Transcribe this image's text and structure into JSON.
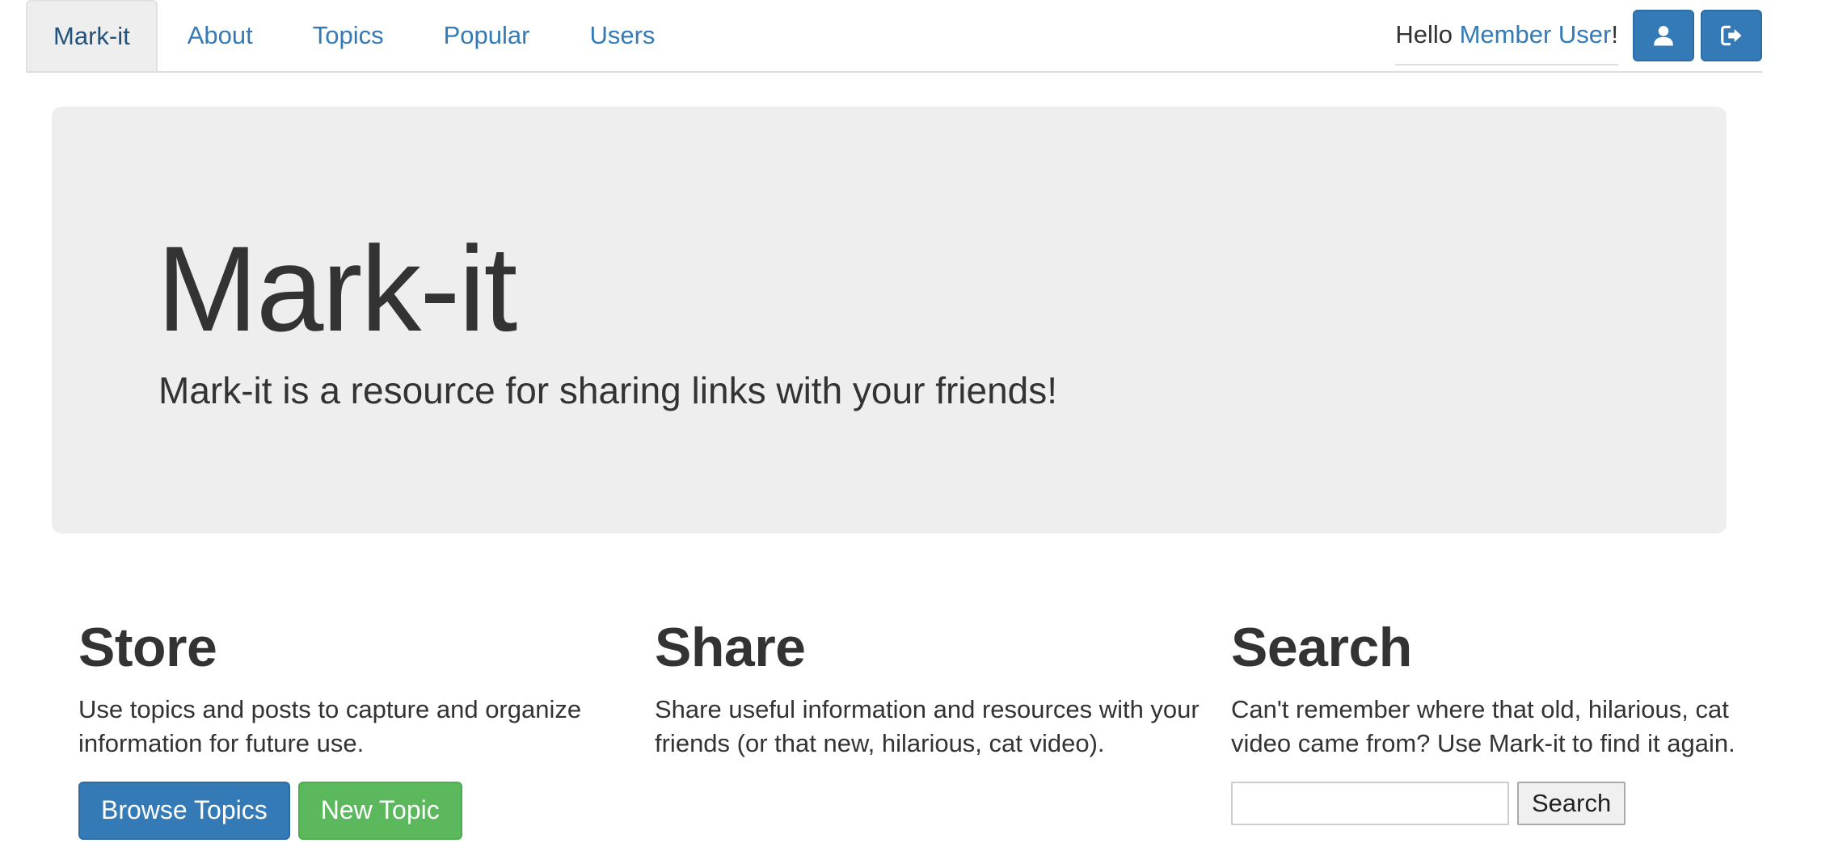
{
  "nav": {
    "tabs": [
      {
        "label": "Mark-it",
        "active": true
      },
      {
        "label": "About"
      },
      {
        "label": "Topics"
      },
      {
        "label": "Popular"
      },
      {
        "label": "Users"
      }
    ],
    "greeting_prefix": "Hello ",
    "username": "Member User",
    "greeting_suffix": "!",
    "profile_icon": "user-icon",
    "logout_icon": "logout-icon"
  },
  "jumbotron": {
    "title": "Mark-it",
    "subtitle": "Mark-it is a resource for sharing links with your friends!"
  },
  "columns": {
    "store": {
      "heading": "Store",
      "text": "Use topics and posts to capture and organize information for future use.",
      "browse_label": "Browse Topics",
      "new_label": "New Topic"
    },
    "share": {
      "heading": "Share",
      "text": "Share useful information and resources with your friends (or that new, hilarious, cat video)."
    },
    "search": {
      "heading": "Search",
      "text": "Can't remember where that old, hilarious, cat video came from? Use Mark-it to find it again.",
      "input_value": "",
      "button_label": "Search"
    }
  },
  "colors": {
    "link": "#337ab7",
    "primary": "#337ab7",
    "success": "#5cb85c",
    "jumbotron_bg": "#eeeeee",
    "text": "#333333"
  }
}
